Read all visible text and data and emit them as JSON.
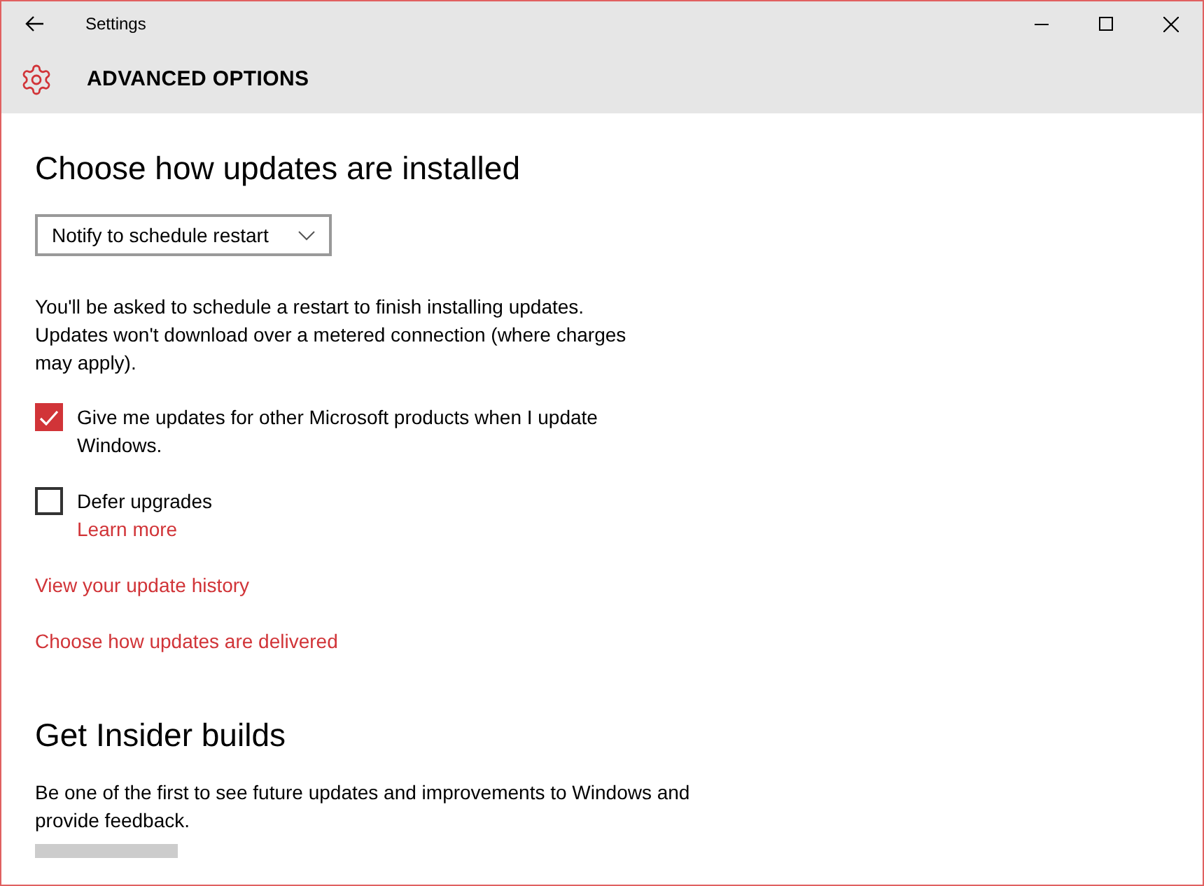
{
  "window": {
    "title": "Settings"
  },
  "header": {
    "title": "ADVANCED OPTIONS"
  },
  "updates": {
    "heading": "Choose how updates are installed",
    "dropdown": {
      "value": "Notify to schedule restart"
    },
    "description": "You'll be asked to schedule a restart to finish installing updates. Updates won't download over a metered connection (where charges may apply)."
  },
  "options": [
    {
      "label": "Give me updates for other Microsoft products when I update Windows.",
      "checked": true
    },
    {
      "label": "Defer upgrades",
      "checked": false,
      "link": "Learn more"
    }
  ],
  "links": [
    "View your update history",
    "Choose how updates are delivered"
  ],
  "insider": {
    "heading": "Get Insider builds",
    "description": "Be one of the first to see future updates and improvements to Windows and provide feedback."
  }
}
